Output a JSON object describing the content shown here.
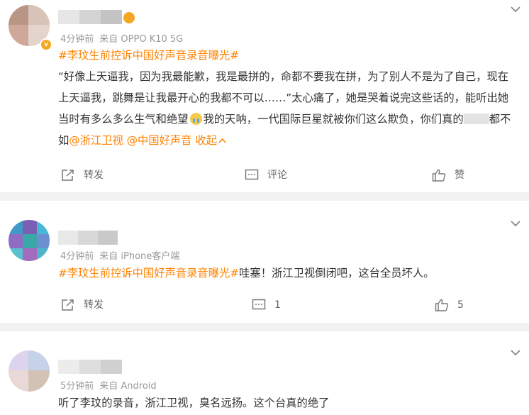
{
  "posts": [
    {
      "time": "4分钟前",
      "source": "来自 OPPO K10 5G",
      "hashtag": "#李玟生前控诉中国好声音录音曝光#",
      "text_part1": "“好像上天逼我，因为我最能歉，我是最拼的，命都不要我在拼，为了别人不是为了自己，现在上天逼我，跳舞是让我最开心的我都不可以……”太心痛了，她是哭着说完这些话的，能听出她当时有多么多么生气和绝望",
      "text_part2": "我的天呐，一代国际巨星就被你们这么欺负，你们真的",
      "text_part3": "都不如",
      "mention1": "@浙江卫视",
      "mention2": "@中国好声音",
      "collapse": "收起",
      "repost_label": "转发",
      "comment_label": "评论",
      "like_label": "赞",
      "crying_emoji": "crying-face"
    },
    {
      "time": "4分钟前",
      "source": "来自 iPhone客户端",
      "hashtag": "#李玟生前控诉中国好声音录音曝光#",
      "text": "哇塞！浙江卫视倒闭吧，这台全员坏人。",
      "repost_label": "转发",
      "comment_count": "1",
      "like_count": "5"
    },
    {
      "time": "5分钟前",
      "source": "来自 Android",
      "text": "听了李玟的录音，浙江卫视，臭名远扬。这个台真的绝了"
    }
  ],
  "colors": {
    "accent": "#ff8200",
    "meta": "#999999",
    "text": "#333333",
    "separator": "#f2f2f2"
  }
}
